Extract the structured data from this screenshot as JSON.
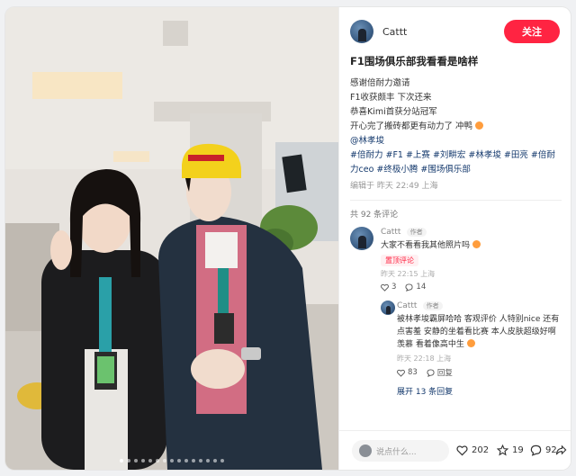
{
  "author": {
    "name": "Cattt",
    "follow_label": "关注"
  },
  "post": {
    "title": "F1围场俱乐部我看看是啥样",
    "lines": [
      "感谢倍耐力邀请",
      "F1收获颇丰 下次还来",
      "恭喜Kimi首获分站冠军",
      "开心完了搬砖都更有动力了 冲鸭"
    ],
    "mention": "@林孝埈",
    "tags": "#倍耐力 #F1 #上赛 #刘畊宏 #林孝埈 #田亮 #倍耐力ceo #终极小腾 #围场俱乐部",
    "meta": "编辑于 昨天 22:49 上海"
  },
  "comments_header": "共 92 条评论",
  "comments": [
    {
      "name": "Cattt",
      "tag": "作者",
      "text": "大家不看看我其他照片吗",
      "badge": "置顶评论",
      "time": "昨天 22:15 上海",
      "likes": "3",
      "replies": "14"
    }
  ],
  "reply": {
    "name": "Cattt",
    "tag": "作者",
    "text": "被林孝埈霸屏哈哈 客观评价 人特别nice 还有点害羞 安静的坐着看比赛 本人皮肤超级好啊 羡慕 看着像高中生",
    "time": "昨天 22:18 上海",
    "likes": "83",
    "reply_label": "回复"
  },
  "expand_label": "展开 13 条回复",
  "bottom": {
    "say_placeholder": "说点什么...",
    "likes": "202",
    "stars": "19",
    "comments": "92"
  },
  "colors": {
    "accent": "#ff2442",
    "link": "#13386c"
  }
}
